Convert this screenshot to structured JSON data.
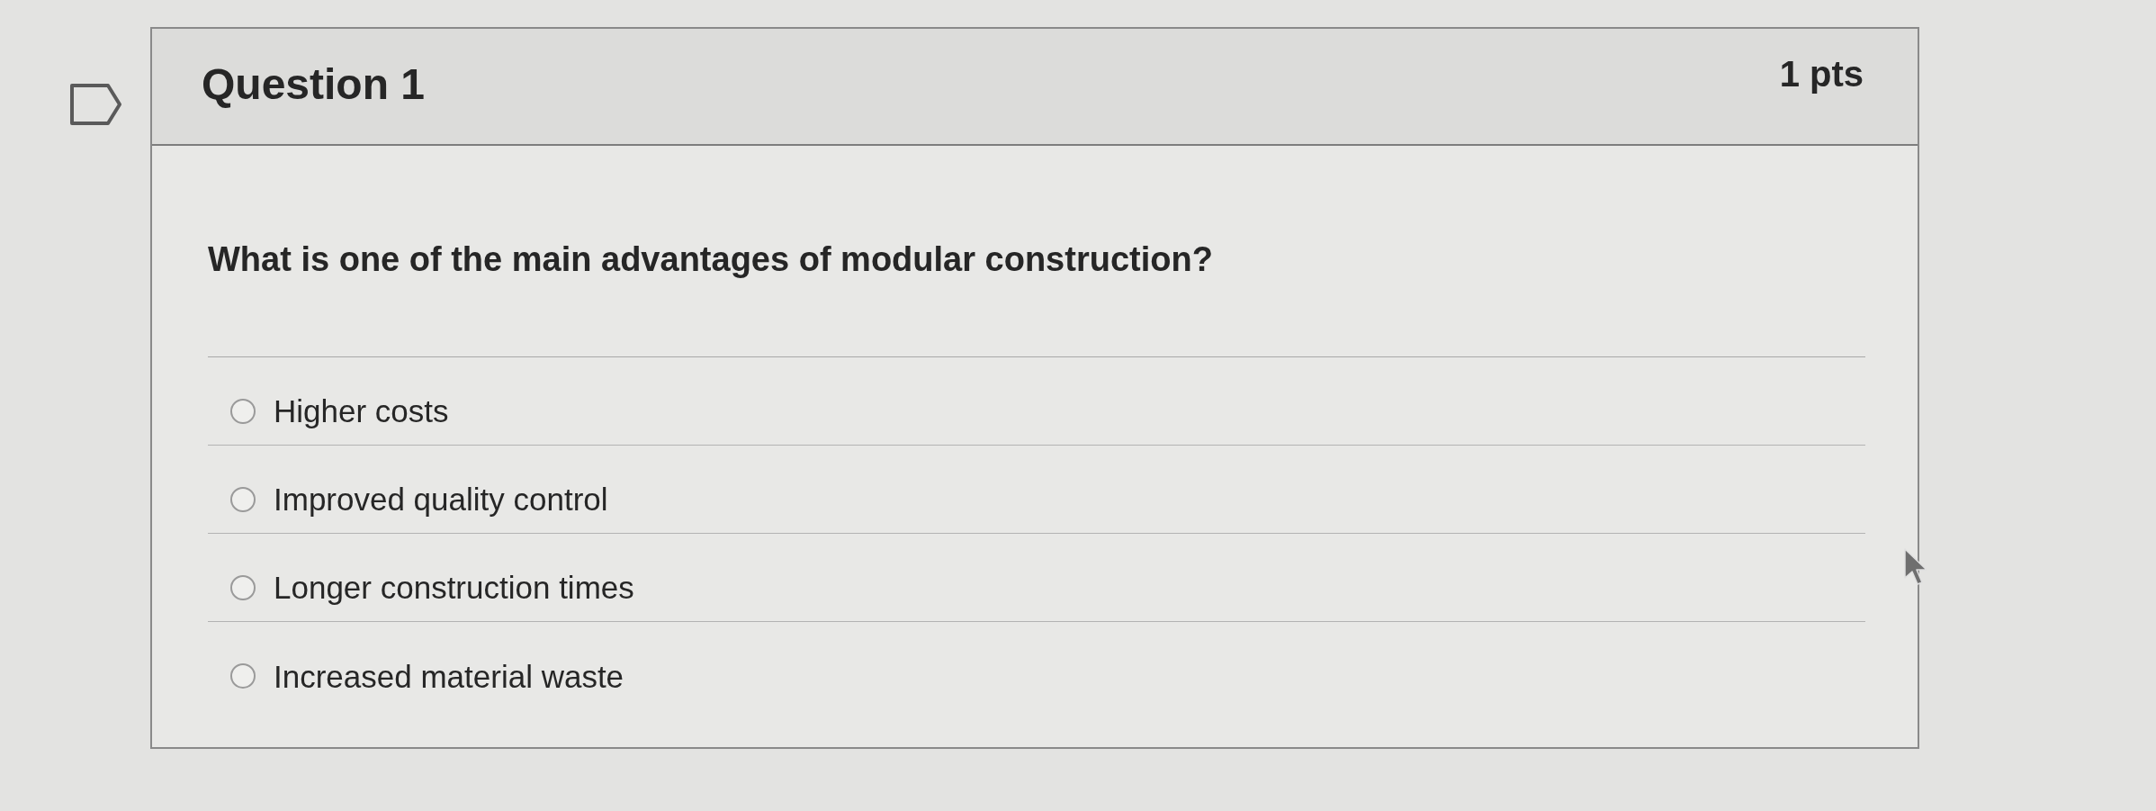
{
  "question": {
    "title": "Question 1",
    "points": "1 pts",
    "text": "What is one of the main advantages of modular construction?",
    "options": [
      {
        "label": "Higher costs",
        "selected": false
      },
      {
        "label": "Improved quality control",
        "selected": false
      },
      {
        "label": "Longer construction times",
        "selected": false
      },
      {
        "label": "Increased material waste",
        "selected": false
      }
    ]
  }
}
